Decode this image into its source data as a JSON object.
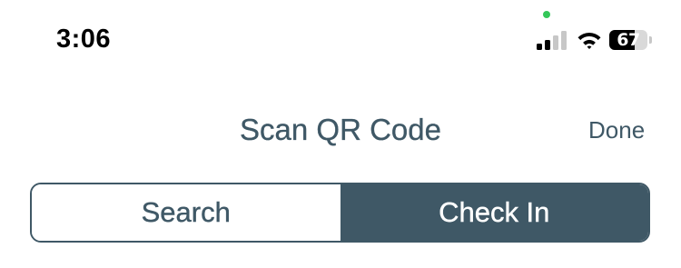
{
  "status_bar": {
    "time": "3:06",
    "signal": {
      "bars_active": 2,
      "bars_total": 4,
      "active_color": "#000000",
      "inactive_color": "#c7c7c7"
    },
    "wifi_icon": "wifi-icon",
    "privacy_dot_color": "#34c759",
    "battery": {
      "level_label": "67",
      "level": 0.67
    }
  },
  "nav": {
    "title": "Scan QR Code",
    "done_label": "Done"
  },
  "segmented_control": {
    "options": [
      {
        "label": "Search",
        "selected": false
      },
      {
        "label": "Check In",
        "selected": true
      }
    ]
  },
  "colors": {
    "accent": "#3f5866",
    "background": "#ffffff"
  }
}
